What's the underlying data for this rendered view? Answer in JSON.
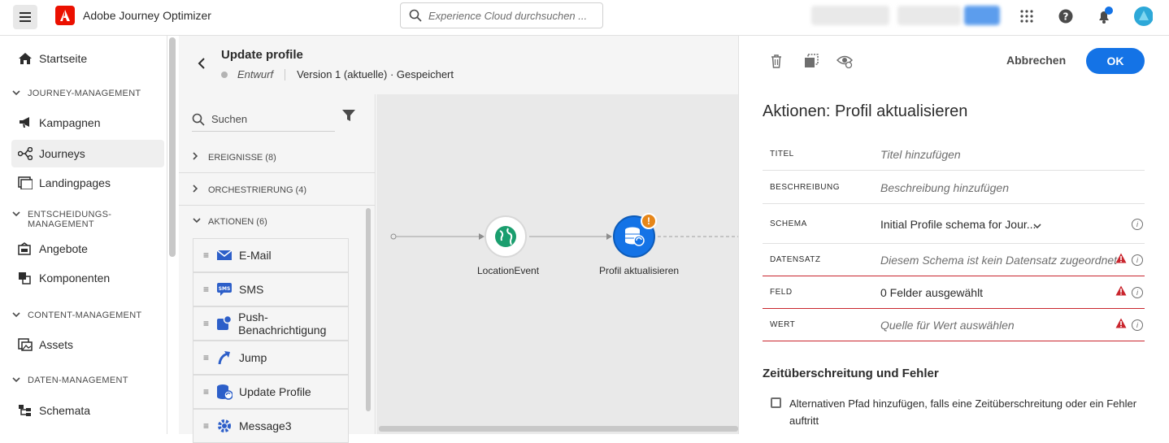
{
  "topbar": {
    "app_title": "Adobe Journey Optimizer",
    "search_placeholder": "Experience Cloud durchsuchen ..."
  },
  "sidebar": {
    "home": "Startseite",
    "sections": {
      "journey_mgmt": "JOURNEY-MANAGEMENT",
      "decision_mgmt_line1": "ENTSCHEIDUNGS-",
      "decision_mgmt_line2": "MANAGEMENT",
      "content_mgmt": "CONTENT-MANAGEMENT",
      "data_mgmt": "DATEN-MANAGEMENT"
    },
    "items": {
      "campaigns": "Kampagnen",
      "journeys": "Journeys",
      "landingpages": "Landingpages",
      "offers": "Angebote",
      "components": "Komponenten",
      "assets": "Assets",
      "schemas": "Schemata"
    }
  },
  "journey": {
    "title": "Update profile",
    "status": "Entwurf",
    "version": "Version 1 (aktuelle) · Gespeichert"
  },
  "palette": {
    "search": "Suchen",
    "categories": {
      "events": "EREIGNISSE (8)",
      "orchestration": "ORCHESTRIERUNG (4)",
      "actions": "AKTIONEN (6)"
    },
    "actions": [
      "E-Mail",
      "SMS",
      "Push-Benachrichtigung",
      "Jump",
      "Update Profile",
      "Message3"
    ]
  },
  "canvas": {
    "node1": "LocationEvent",
    "node2": "Profil aktualisieren",
    "warning_glyph": "!"
  },
  "panel": {
    "cancel": "Abbrechen",
    "ok": "OK",
    "title": "Aktionen: Profil aktualisieren",
    "fields": {
      "title_label": "TITEL",
      "title_value": "Titel hinzufügen",
      "desc_label": "BESCHREIBUNG",
      "desc_value": "Beschreibung hinzufügen",
      "schema_label": "SCHEMA",
      "schema_value": "Initial Profile schema for Jour...",
      "dataset_label": "DATENSATZ",
      "dataset_value": "Diesem Schema ist kein Datensatz zugeordnet",
      "field_label": "FELD",
      "field_value": "0 Felder ausgewählt",
      "value_label": "WERT",
      "value_value": "Quelle für Wert auswählen"
    },
    "info_glyph": "i",
    "timeout_title": "Zeitüberschreitung und Fehler",
    "timeout_checkbox": "Alternativen Pfad hinzufügen, falls eine Zeitüberschreitung oder ein Fehler auftritt"
  },
  "colors": {
    "accent": "#1473e6",
    "error": "#c9252d",
    "warning": "#e68619",
    "adobe_red": "#eb1000"
  }
}
